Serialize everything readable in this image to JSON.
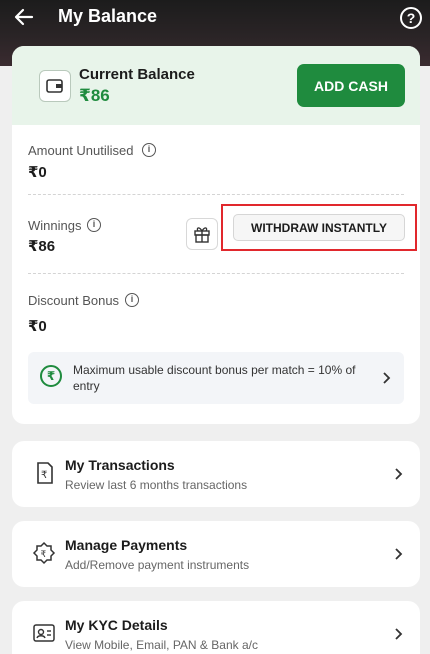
{
  "header": {
    "title": "My Balance"
  },
  "balance": {
    "label": "Current Balance",
    "value": "₹86",
    "add_cash_label": "ADD CASH"
  },
  "rows": {
    "unutilised": {
      "label": "Amount Unutilised",
      "value": "₹0"
    },
    "winnings": {
      "label": "Winnings",
      "value": "₹86",
      "withdraw_label": "WITHDRAW INSTANTLY"
    },
    "discount": {
      "label": "Discount Bonus",
      "value": "₹0"
    }
  },
  "notice": {
    "text": "Maximum usable discount bonus per match = 10% of entry"
  },
  "menu": {
    "transactions": {
      "title": "My Transactions",
      "subtitle": "Review last 6 months transactions"
    },
    "payments": {
      "title": "Manage Payments",
      "subtitle": "Add/Remove payment instruments"
    },
    "kyc": {
      "title": "My KYC Details",
      "subtitle": "View Mobile, Email, PAN & Bank a/c"
    }
  },
  "colors": {
    "accent": "#1f8b3e",
    "highlight": "#e1282d"
  }
}
